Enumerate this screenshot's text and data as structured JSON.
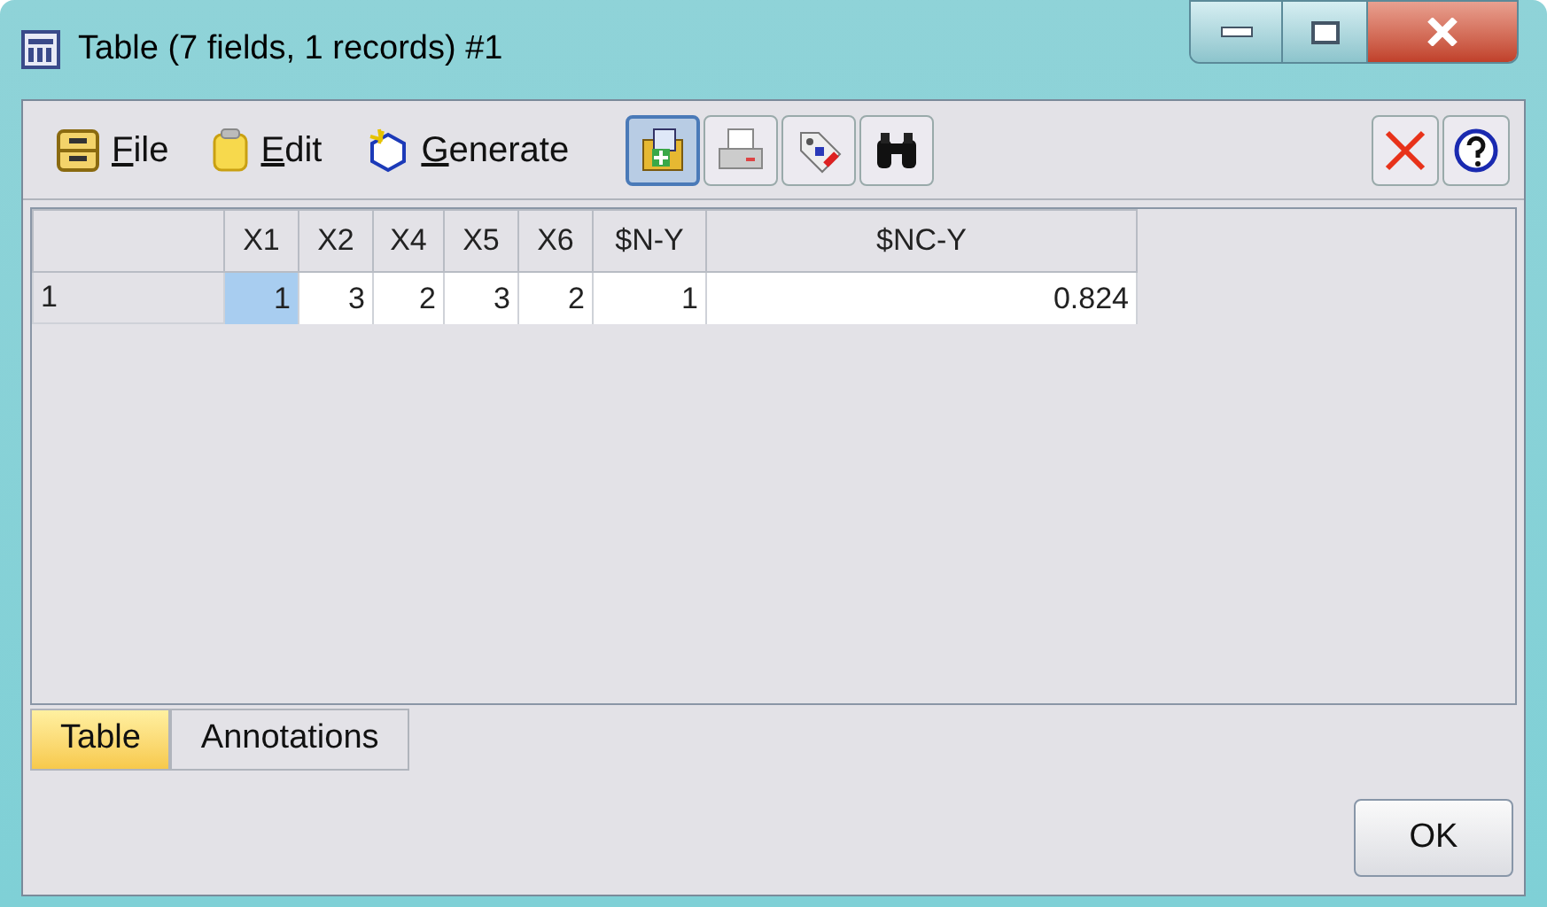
{
  "window": {
    "title": "Table (7 fields, 1 records) #1"
  },
  "menu": [
    {
      "label": "File"
    },
    {
      "label": "Edit"
    },
    {
      "label": "Generate"
    }
  ],
  "toolbar": [
    {
      "selected": true
    },
    {
      "selected": false
    },
    {
      "selected": false
    },
    {
      "selected": false
    }
  ],
  "table": {
    "columns": [
      "",
      "X1",
      "X2",
      "X4",
      "X5",
      "X6",
      "$N-Y",
      "$NC-Y"
    ],
    "rows": [
      {
        "cells": [
          {
            "text": "1",
            "selected": false
          },
          {
            "text": "1",
            "selected": true
          },
          {
            "text": "3",
            "selected": false
          },
          {
            "text": "2",
            "selected": false
          },
          {
            "text": "3",
            "selected": false
          },
          {
            "text": "2",
            "selected": false
          },
          {
            "text": "1",
            "selected": false
          },
          {
            "text": "0.824",
            "selected": false
          }
        ]
      }
    ]
  },
  "tabs": [
    {
      "label": "Table",
      "selected": true
    },
    {
      "label": "Annotations",
      "selected": false
    }
  ],
  "buttons": [
    "OK"
  ]
}
